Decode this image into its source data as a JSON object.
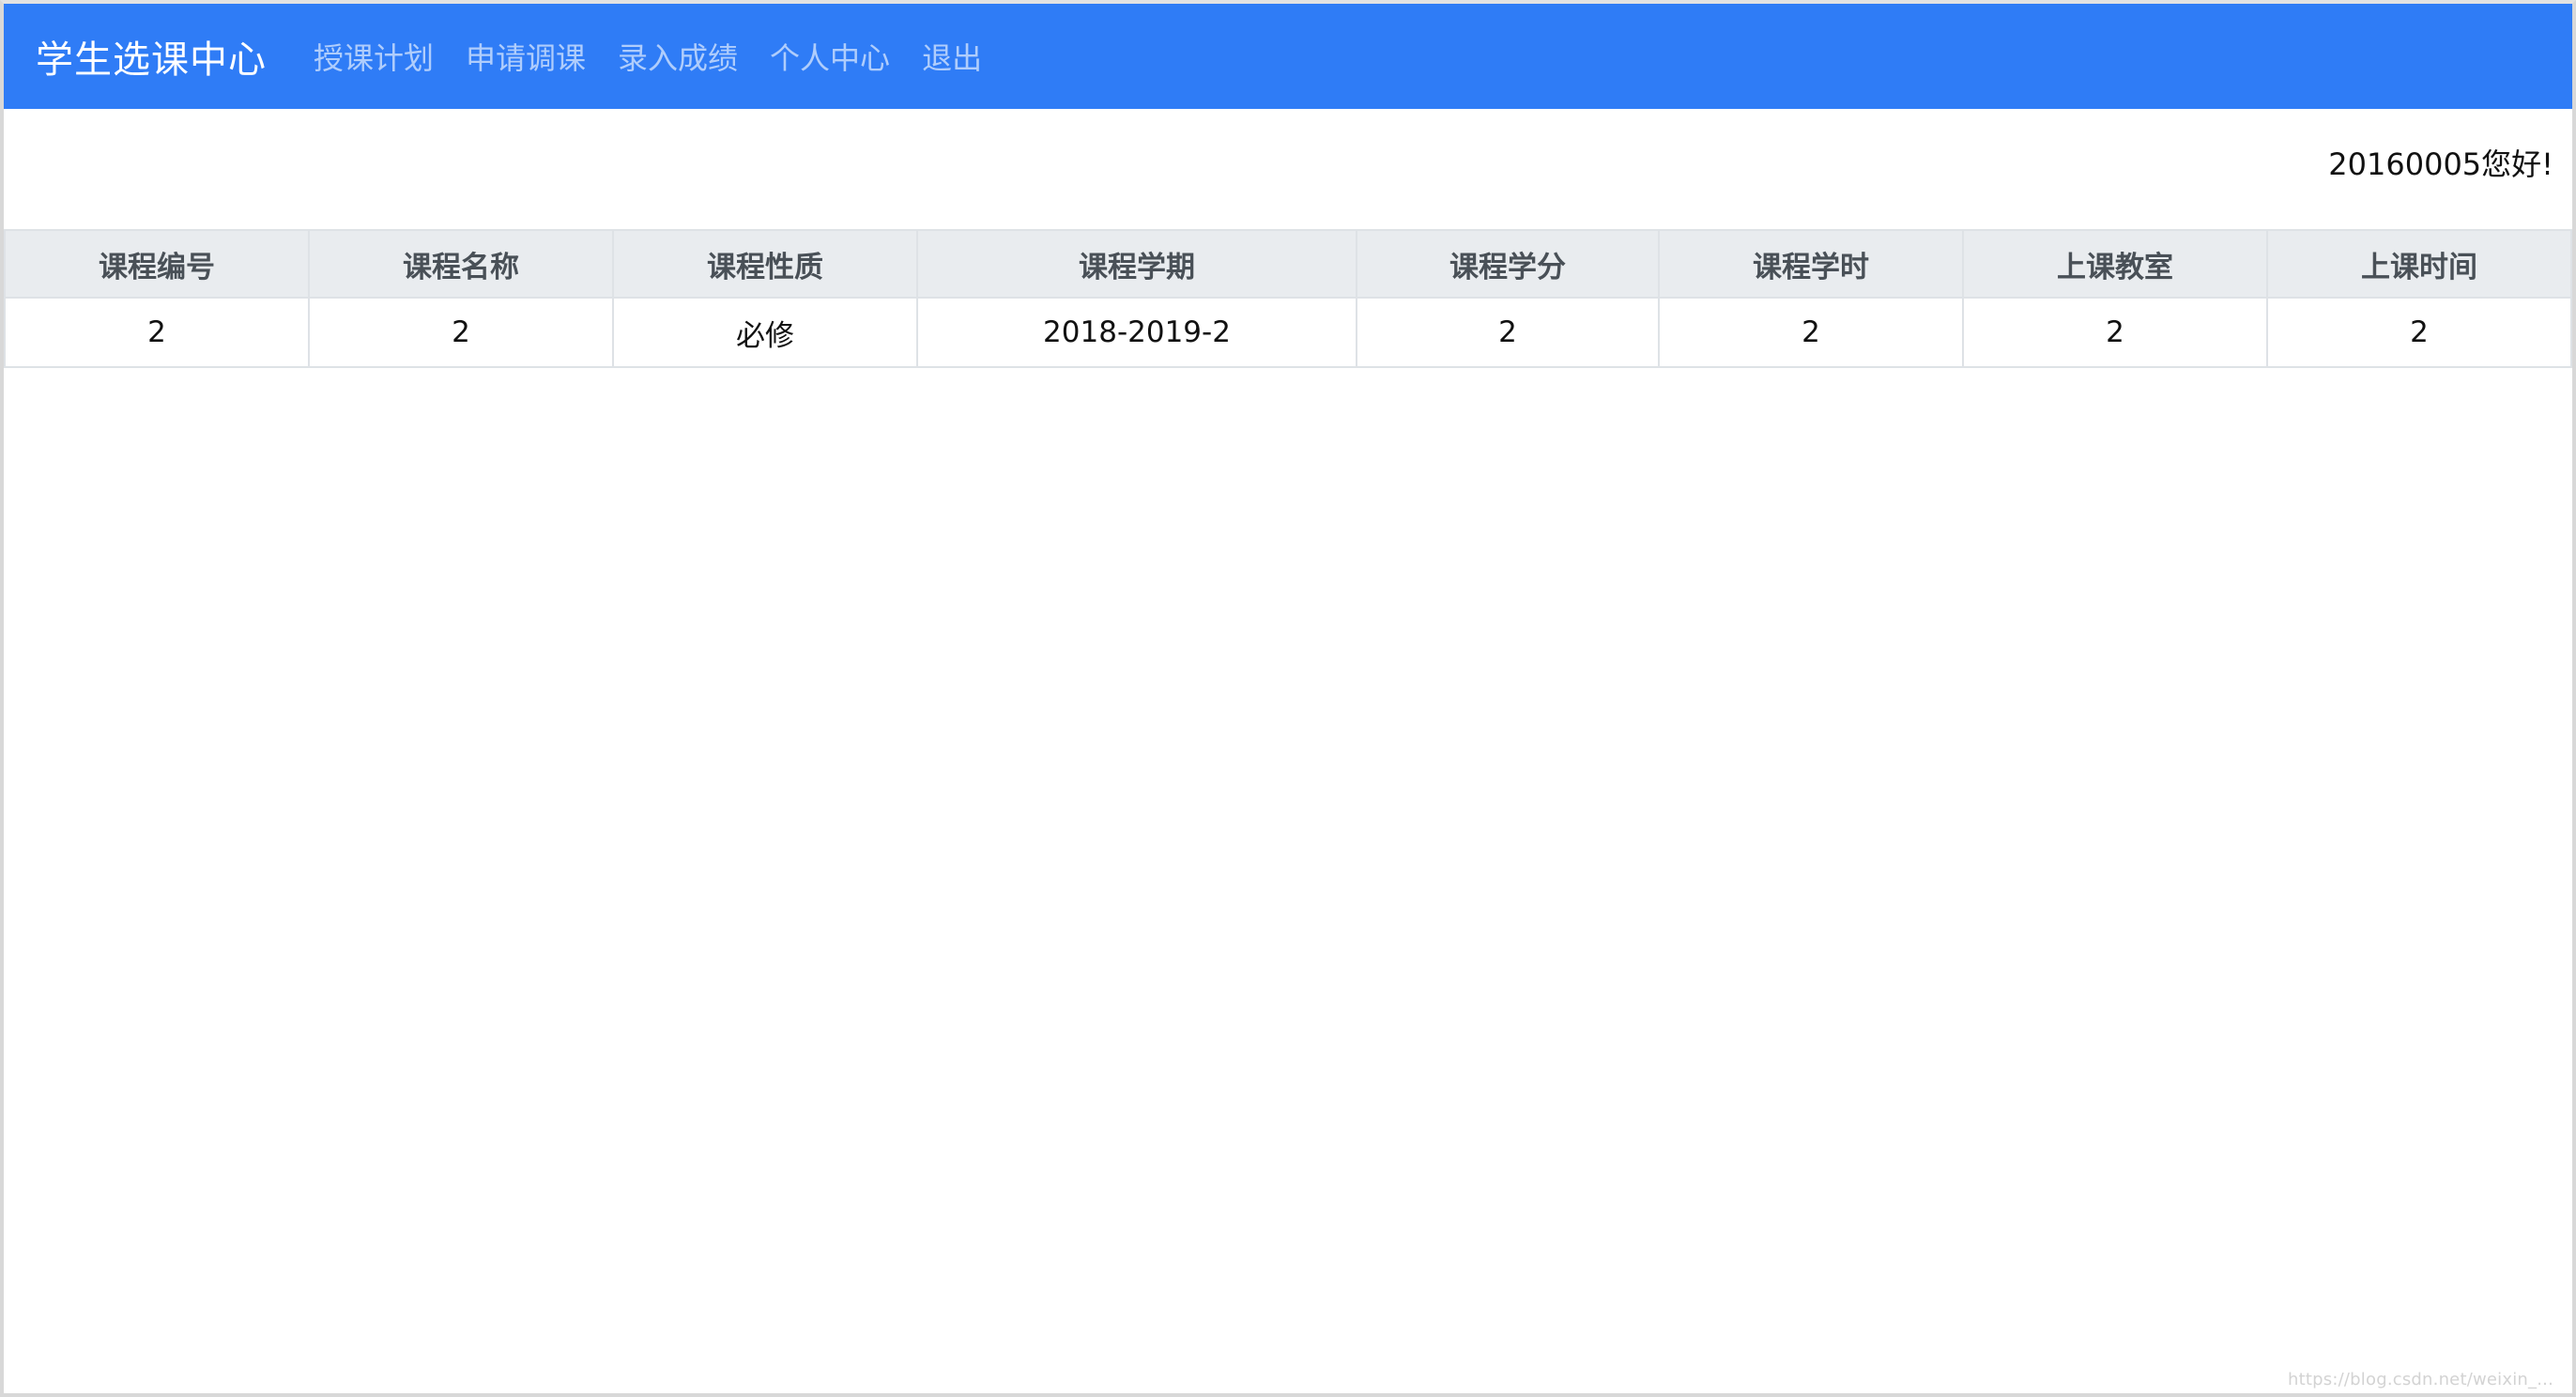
{
  "header": {
    "brand": "学生选课中心",
    "nav": [
      "授课计划",
      "申请调课",
      "录入成绩",
      "个人中心",
      "退出"
    ]
  },
  "user": {
    "greeting": "20160005您好!"
  },
  "table": {
    "columns": [
      "课程编号",
      "课程名称",
      "课程性质",
      "课程学期",
      "课程学分",
      "课程学时",
      "上课教室",
      "上课时间"
    ],
    "rows": [
      [
        "2",
        "2",
        "必修",
        "2018-2019-2",
        "2",
        "2",
        "2",
        "2"
      ]
    ]
  },
  "watermark": "https://blog.csdn.net/weixin_..."
}
